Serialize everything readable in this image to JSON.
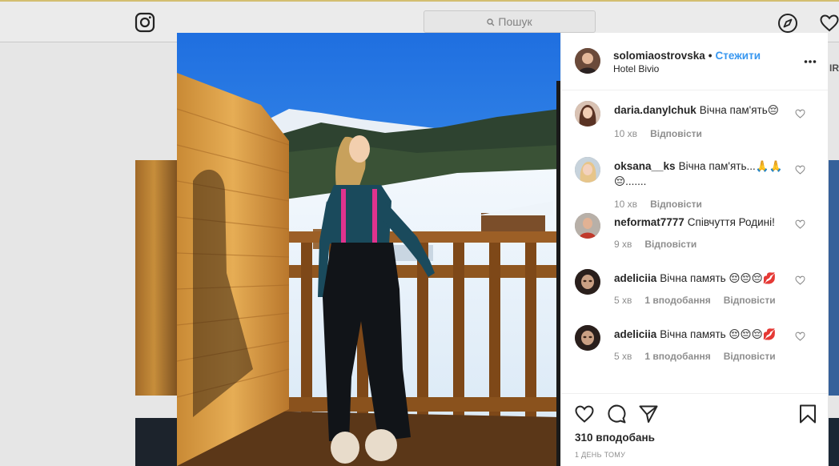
{
  "search": {
    "placeholder": "Пошук"
  },
  "background": {
    "right_text_fragment": "IR"
  },
  "post": {
    "username": "solomiaostrovska",
    "follow_label": "Стежити",
    "location": "Hotel Bivio",
    "likes_text": "310 вподобань",
    "timestamp": "1 день тому"
  },
  "comments": [
    {
      "user": "daria.danylchuk",
      "text": "Вічна пам'ять😔",
      "time": "10 хв",
      "likes": "",
      "reply": "Відповісти"
    },
    {
      "user": "oksana__ks",
      "text": "Вічна пам'ять...🙏🙏😔.......",
      "time": "10 хв",
      "likes": "",
      "reply": "Відповісти"
    },
    {
      "user": "neformat7777",
      "text": "Співчуття Родині!",
      "time": "9 хв",
      "likes": "",
      "reply": "Відповісти"
    },
    {
      "user": "adeliciia",
      "text": "Вічна память 😔😔😔💋",
      "time": "5 хв",
      "likes": "1 вподобання",
      "reply": "Відповісти"
    },
    {
      "user": "adeliciia",
      "text": "Вічна память 😔😔😔💋",
      "time": "5 хв",
      "likes": "1 вподобання",
      "reply": "Відповісти"
    }
  ],
  "icons": {
    "logo": "instagram-logo-icon",
    "explore": "compass-icon",
    "activity": "heart-icon",
    "options": "more-options-icon",
    "like": "heart-outline-icon",
    "comment": "comment-bubble-icon",
    "share": "paper-plane-icon",
    "save": "bookmark-icon"
  },
  "colors": {
    "accent_link": "#3897f0",
    "meta_gray": "#8e8e8e",
    "text": "#262626"
  }
}
